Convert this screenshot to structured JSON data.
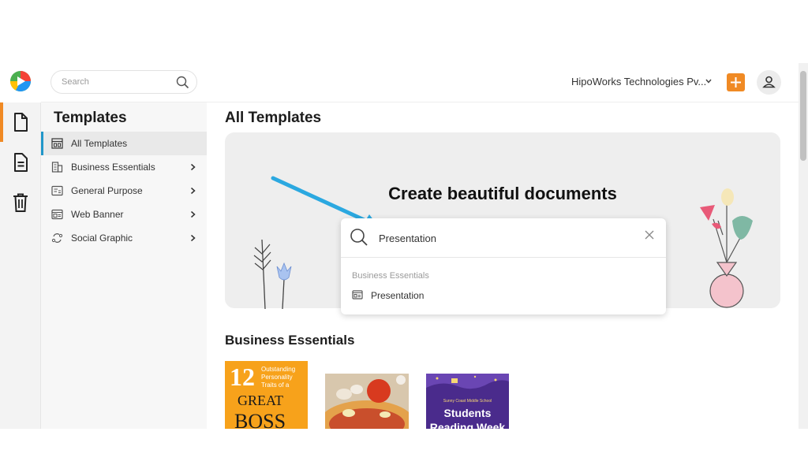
{
  "header": {
    "search_placeholder": "Search",
    "org_name": "HipoWorks Technologies Pv...",
    "accent": "#f08a24"
  },
  "rail": {
    "items": [
      "file-icon",
      "document-icon",
      "trash-icon"
    ]
  },
  "sidebar": {
    "title": "Templates",
    "items": [
      {
        "label": "All Templates",
        "icon": "layout-icon",
        "active": true
      },
      {
        "label": "Business Essentials",
        "icon": "building-icon"
      },
      {
        "label": "General Purpose",
        "icon": "list-card-icon"
      },
      {
        "label": "Web Banner",
        "icon": "banner-icon"
      },
      {
        "label": "Social Graphic",
        "icon": "share-icon"
      }
    ]
  },
  "main": {
    "title": "All Templates",
    "hero": {
      "title": "Create beautiful documents",
      "search_value": "Presentation",
      "result_group": "Business Essentials",
      "result_item": "Presentation"
    },
    "section_title": "Business Essentials",
    "thumbnails": [
      {
        "lines": [
          "12",
          "Outstanding",
          "Personality",
          "Traits of a",
          "GREAT",
          "BOSS"
        ]
      },
      {
        "lines": []
      },
      {
        "lines": [
          "Sunny Coast Middle School",
          "Students",
          "Reading Week"
        ]
      }
    ]
  }
}
